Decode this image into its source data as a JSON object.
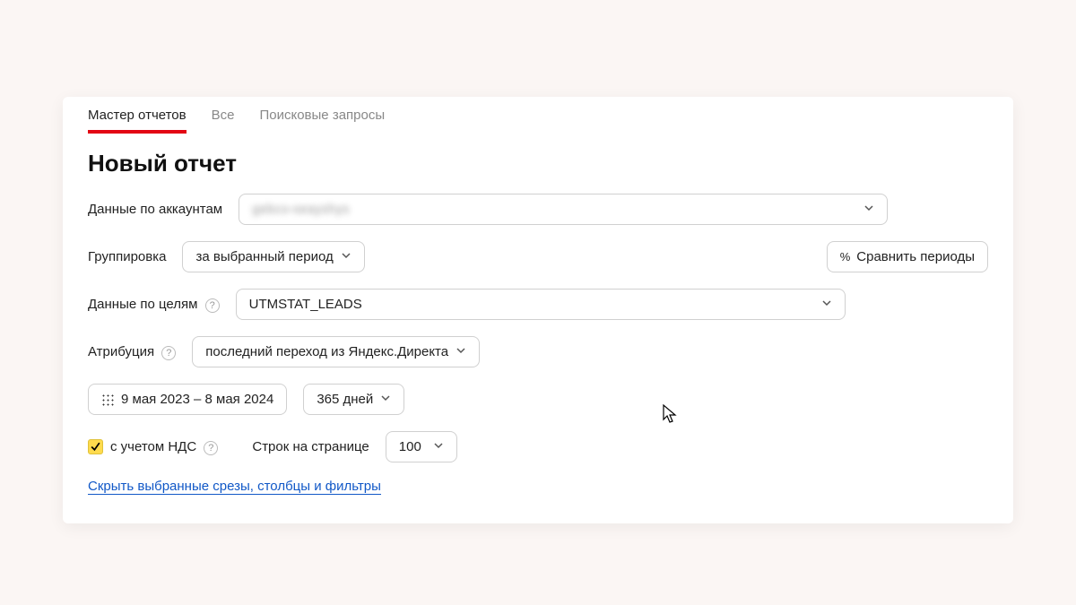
{
  "tabs": {
    "master": "Мастер отчетов",
    "all": "Все",
    "search": "Поисковые запросы"
  },
  "title": "Новый отчет",
  "accounts": {
    "label": "Данные по аккаунтам",
    "value": "gebco-seayshys"
  },
  "grouping": {
    "label": "Группировка",
    "value": "за выбранный период"
  },
  "compare_button": "Сравнить периоды",
  "goals": {
    "label": "Данные по целям",
    "value": "UTMSTAT_LEADS"
  },
  "attribution": {
    "label": "Атрибуция",
    "value": "последний переход из Яндекс.Директа"
  },
  "date_range": "9 мая 2023 – 8 мая 2024",
  "days_preset": "365 дней",
  "vat_checkbox": "с учетом НДС",
  "rows_label": "Строк на странице",
  "rows_value": "100",
  "hide_link": "Скрыть выбранные срезы, столбцы и фильтры"
}
